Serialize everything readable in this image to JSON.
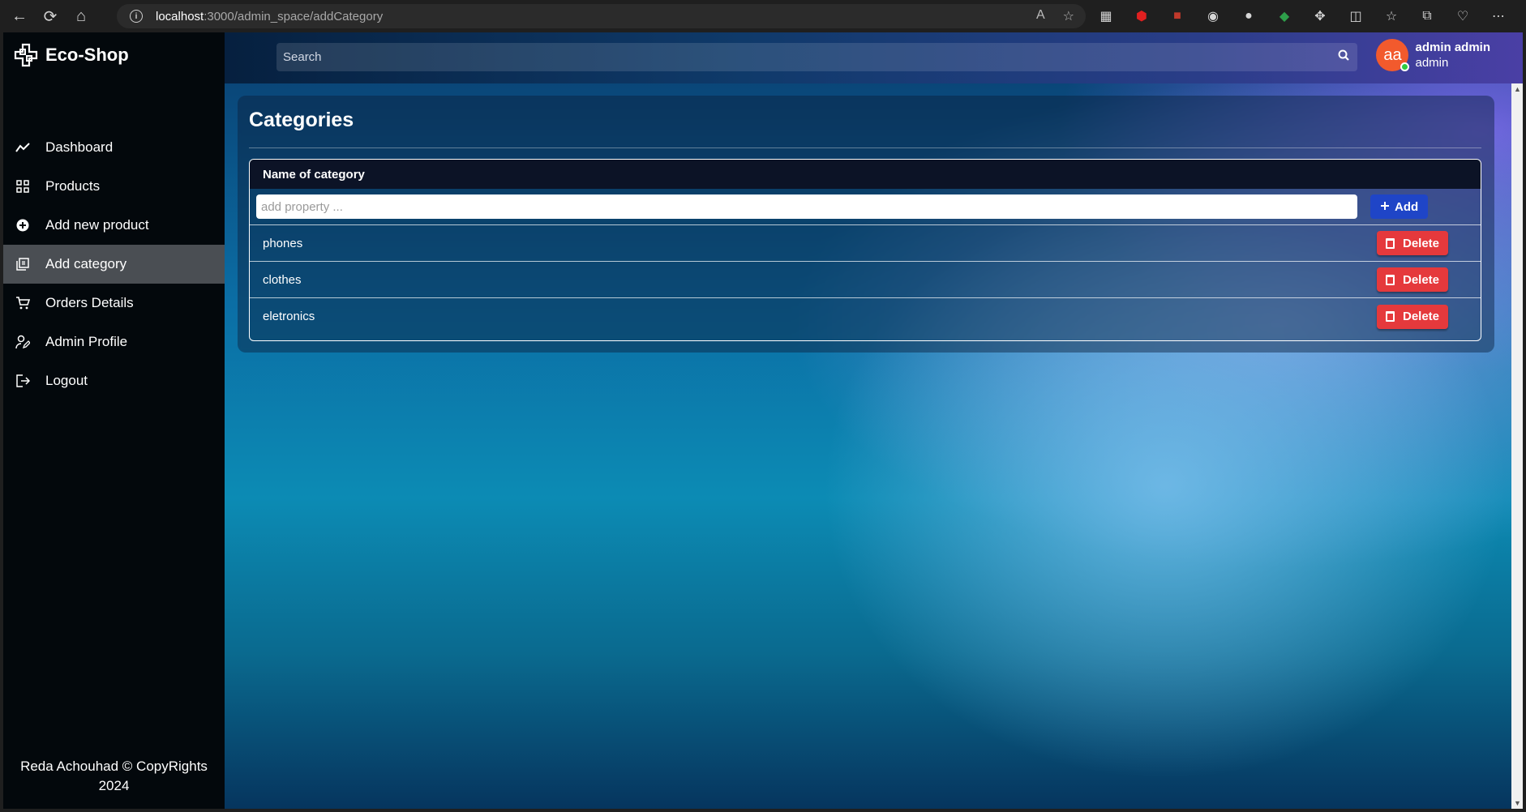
{
  "browser": {
    "url_host": "localhost",
    "url_rest": ":3000/admin_space/addCategory"
  },
  "sidebar": {
    "brand": "Eco-Shop",
    "items": [
      {
        "label": "Dashboard",
        "icon": "chart-line-icon"
      },
      {
        "label": "Products",
        "icon": "grid-icon"
      },
      {
        "label": "Add new product",
        "icon": "plus-circle-icon"
      },
      {
        "label": "Add category",
        "icon": "stack-icon",
        "active": true
      },
      {
        "label": "Orders Details",
        "icon": "cart-icon"
      },
      {
        "label": "Admin Profile",
        "icon": "user-edit-icon"
      },
      {
        "label": "Logout",
        "icon": "logout-icon"
      }
    ],
    "footer_line1": "Reda Achouhad © CopyRights",
    "footer_line2": "2024"
  },
  "header": {
    "search_placeholder": "Search",
    "avatar_initials": "aa",
    "user_name": "admin admin",
    "user_role": "admin"
  },
  "main": {
    "title": "Categories",
    "table_header": "Name of category",
    "input_placeholder": "add property ...",
    "add_label": "Add",
    "delete_label": "Delete",
    "categories": [
      "phones",
      "clothes",
      "eletronics"
    ]
  },
  "colors": {
    "sidebar_bg": "#03080c",
    "active_item": "#4a4e53",
    "add_button": "#1f45c7",
    "delete_button": "#e5393c",
    "avatar": "#f25a2d",
    "online": "#2ecc40"
  }
}
